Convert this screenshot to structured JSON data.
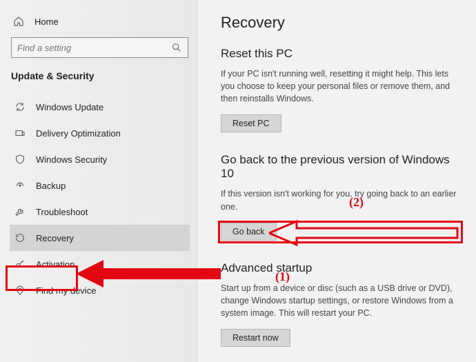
{
  "sidebar": {
    "home_label": "Home",
    "search_placeholder": "Find a setting",
    "section_title": "Update & Security",
    "items": [
      {
        "label": "Windows Update"
      },
      {
        "label": "Delivery Optimization"
      },
      {
        "label": "Windows Security"
      },
      {
        "label": "Backup"
      },
      {
        "label": "Troubleshoot"
      },
      {
        "label": "Recovery"
      },
      {
        "label": "Activation"
      },
      {
        "label": "Find my device"
      }
    ],
    "selected_index": 5
  },
  "content": {
    "page_title": "Recovery",
    "reset": {
      "heading": "Reset this PC",
      "desc": "If your PC isn't running well, resetting it might help. This lets you choose to keep your personal files or remove them, and then reinstalls Windows.",
      "button": "Reset PC"
    },
    "goback": {
      "heading": "Go back to the previous version of Windows 10",
      "desc": "If this version isn't working for you, try going back to an earlier one.",
      "button": "Go back"
    },
    "advanced": {
      "heading": "Advanced startup",
      "desc": "Start up from a device or disc (such as a USB drive or DVD), change Windows startup settings, or restore Windows from a system image. This will restart your PC.",
      "button": "Restart now"
    }
  },
  "annotations": {
    "one": "(1)",
    "two": "(2)"
  }
}
